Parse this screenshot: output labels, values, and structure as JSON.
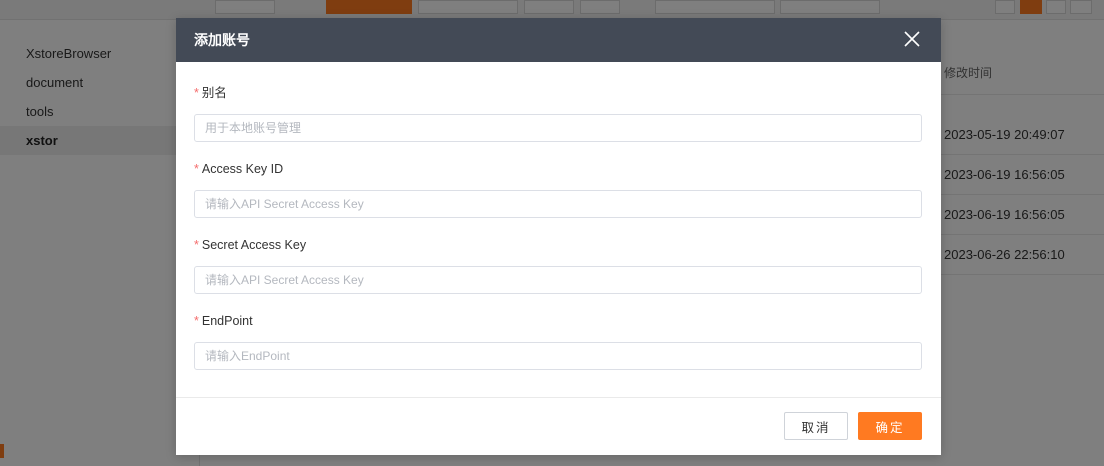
{
  "sidebar": {
    "items": [
      {
        "label": "XstoreBrowser"
      },
      {
        "label": "document"
      },
      {
        "label": "tools"
      },
      {
        "label": "xstor"
      }
    ]
  },
  "table": {
    "modified_header": "修改时间",
    "rows": [
      {
        "modified": "2023-05-19 20:49:07"
      },
      {
        "modified": "2023-06-19 16:56:05"
      },
      {
        "modified": "2023-06-19 16:56:05"
      },
      {
        "modified": "2023-06-26 22:56:10"
      }
    ]
  },
  "modal": {
    "title": "添加账号",
    "close_icon": "close-icon",
    "fields": {
      "alias": {
        "required_mark": "*",
        "label": "别名",
        "placeholder": "用于本地账号管理",
        "value": ""
      },
      "access_key_id": {
        "required_mark": "*",
        "label": "Access Key ID",
        "placeholder": "请输入API Secret Access Key",
        "value": ""
      },
      "secret_access_key": {
        "required_mark": "*",
        "label": "Secret Access Key",
        "placeholder": "请输入API Secret Access Key",
        "value": ""
      },
      "endpoint": {
        "required_mark": "*",
        "label": "EndPoint",
        "placeholder": "请输入EndPoint",
        "value": ""
      }
    },
    "cancel_label": "取消",
    "ok_label": "确定"
  },
  "colors": {
    "accent": "#ff7a21",
    "header_bg": "#434a56",
    "required": "#f56c6c"
  }
}
